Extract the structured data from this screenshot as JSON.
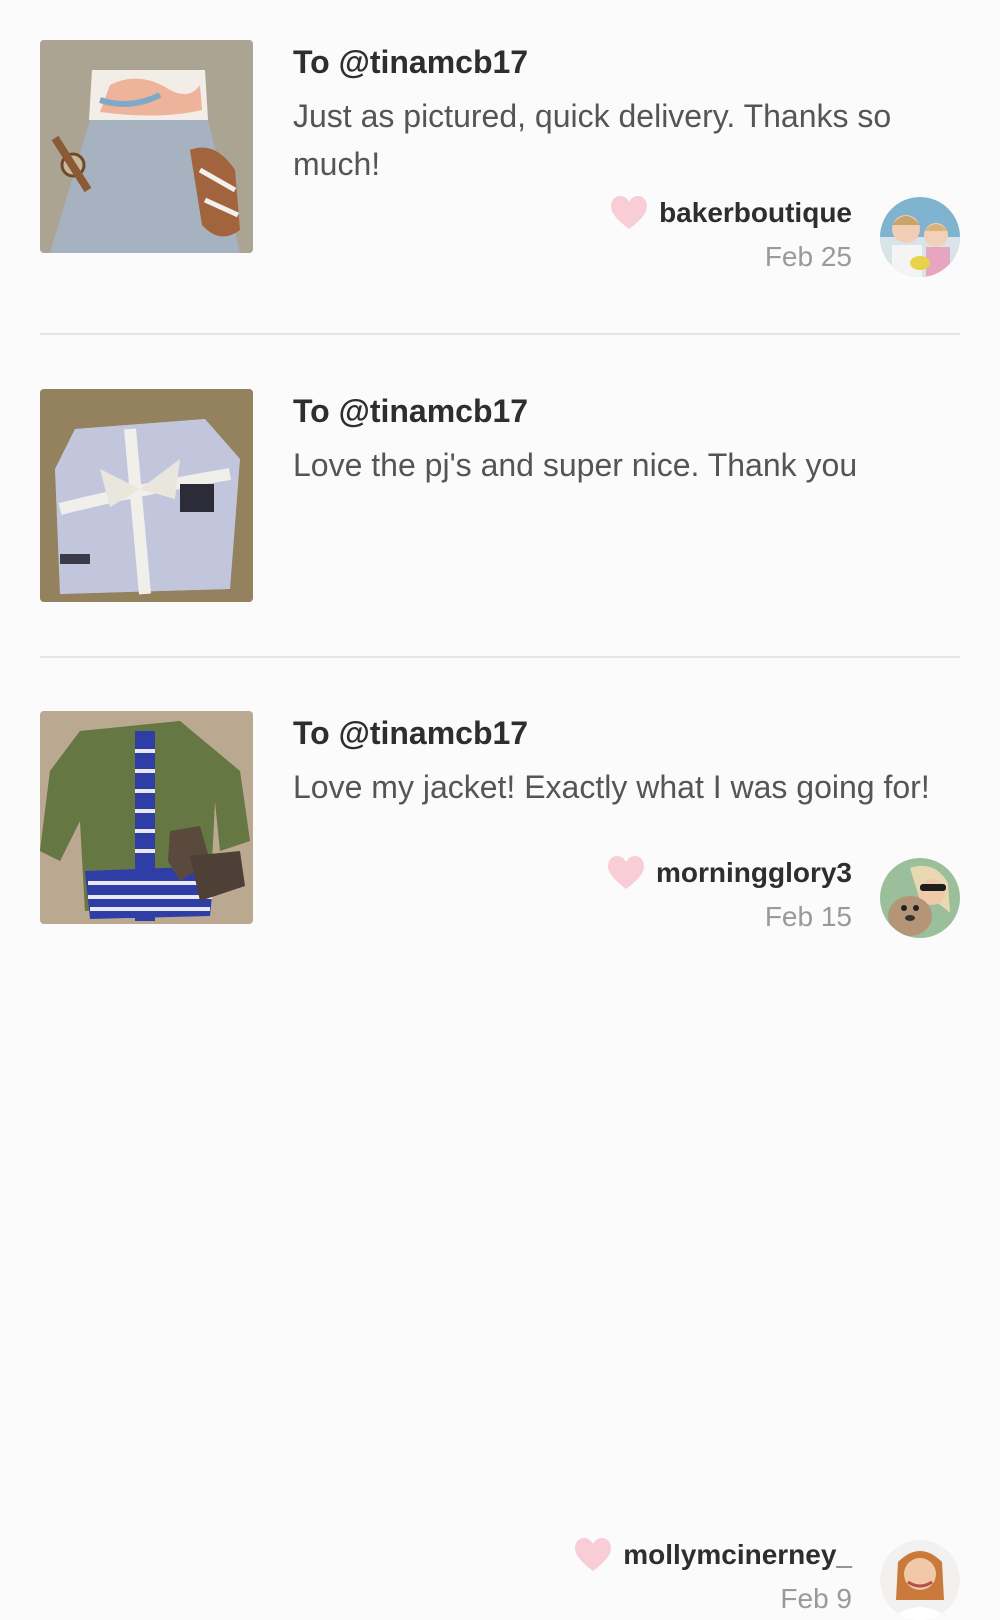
{
  "reviews": [
    {
      "to": "To @tinamcb17",
      "message": "Just as pictured, quick delivery. Thanks so much!",
      "username": "bakerboutique",
      "date": "Feb 25",
      "thumb_icon": "dress-outfit-photo",
      "avatar_icon": "children-avatar-photo"
    },
    {
      "to": "To @tinamcb17",
      "message": "Love the pj's and super nice. Thank you",
      "username": "morningglory3",
      "date": "Feb 15",
      "thumb_icon": "pajamas-package-photo",
      "avatar_icon": "woman-with-dog-avatar-photo"
    },
    {
      "to": "To @tinamcb17",
      "message": "Love my jacket! Exactly what I was going for!",
      "username": "mollymcinerney_",
      "date": "Feb 9",
      "thumb_icon": "jacket-outfit-photo",
      "avatar_icon": "woman-avatar-photo"
    }
  ],
  "colors": {
    "heart": "#f9cdd6",
    "divider": "#e6e4e6",
    "date": "#9a9a9a"
  }
}
